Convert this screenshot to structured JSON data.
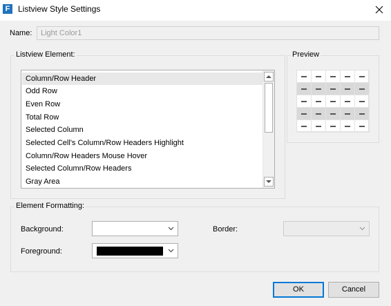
{
  "window": {
    "title": "Listview Style Settings",
    "app_icon_letter": "F"
  },
  "name": {
    "label": "Name:",
    "value": "Light Color1"
  },
  "listview_element": {
    "group_title": "Listview Element:",
    "items": [
      {
        "label": "Column/Row Header",
        "selected": true
      },
      {
        "label": "Odd Row"
      },
      {
        "label": "Even Row"
      },
      {
        "label": "Total Row"
      },
      {
        "label": "Selected Column"
      },
      {
        "label": "Selected Cell's Column/Row Headers Highlight"
      },
      {
        "label": "Column/Row Headers Mouse Hover"
      },
      {
        "label": "Selected Column/Row Headers"
      },
      {
        "label": "Gray Area"
      }
    ]
  },
  "preview": {
    "group_title": "Preview",
    "rows": 5,
    "cols": 5,
    "shaded_rows": [
      1,
      3
    ],
    "shade_color": "#d9d9d9",
    "cell_glyph": "dash"
  },
  "element_formatting": {
    "group_title": "Element Formatting:",
    "background": {
      "label": "Background:",
      "color": "#ffffff"
    },
    "foreground": {
      "label": "Foreground:",
      "color": "#000000"
    },
    "border": {
      "label": "Border:",
      "enabled": false
    }
  },
  "buttons": {
    "ok": "OK",
    "cancel": "Cancel"
  },
  "colors": {
    "accent": "#0078d7",
    "icon_blue": "#1e73be"
  }
}
